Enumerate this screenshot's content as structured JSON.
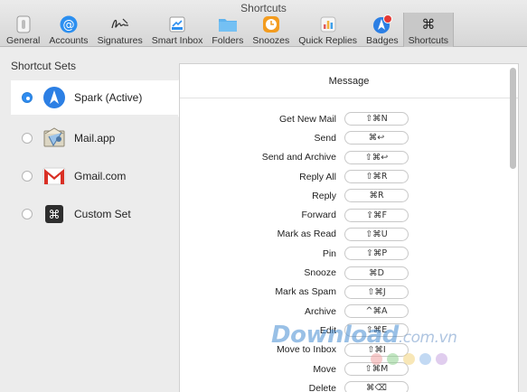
{
  "window": {
    "title": "Shortcuts"
  },
  "toolbar": {
    "items": [
      {
        "label": "General",
        "icon": "switch-icon"
      },
      {
        "label": "Accounts",
        "icon": "at-icon"
      },
      {
        "label": "Signatures",
        "icon": "signature-icon"
      },
      {
        "label": "Smart Inbox",
        "icon": "smart-inbox-icon"
      },
      {
        "label": "Folders",
        "icon": "folder-icon"
      },
      {
        "label": "Snoozes",
        "icon": "clock-icon"
      },
      {
        "label": "Quick Replies",
        "icon": "quick-replies-icon"
      },
      {
        "label": "Badges",
        "icon": "spark-badge-icon"
      },
      {
        "label": "Shortcuts",
        "icon": "command-icon"
      }
    ],
    "active": "Shortcuts"
  },
  "sets": {
    "heading": "Shortcut Sets",
    "items": [
      {
        "label": "Spark (Active)",
        "icon": "spark-icon",
        "selected": true
      },
      {
        "label": "Mail.app",
        "icon": "mail-app-icon",
        "selected": false
      },
      {
        "label": "Gmail.com",
        "icon": "gmail-icon",
        "selected": false
      },
      {
        "label": "Custom Set",
        "icon": "command-key-icon",
        "selected": false
      }
    ]
  },
  "panel": {
    "section": "Message",
    "shortcuts": [
      {
        "action": "Get New Mail",
        "keys": "⇧⌘N"
      },
      {
        "action": "Send",
        "keys": "⌘↩"
      },
      {
        "action": "Send and Archive",
        "keys": "⇧⌘↩"
      },
      {
        "action": "Reply All",
        "keys": "⇧⌘R"
      },
      {
        "action": "Reply",
        "keys": "⌘R"
      },
      {
        "action": "Forward",
        "keys": "⇧⌘F"
      },
      {
        "action": "Mark as Read",
        "keys": "⇧⌘U"
      },
      {
        "action": "Pin",
        "keys": "⇧⌘P"
      },
      {
        "action": "Snooze",
        "keys": "⌘D"
      },
      {
        "action": "Mark as Spam",
        "keys": "⇧⌘J"
      },
      {
        "action": "Archive",
        "keys": "^⌘A"
      },
      {
        "action": "Edit",
        "keys": "⇧⌘E"
      },
      {
        "action": "Move to Inbox",
        "keys": "⇧⌘I"
      },
      {
        "action": "Move",
        "keys": "⇧⌘M"
      },
      {
        "action": "Delete",
        "keys": "⌘⌫"
      }
    ]
  },
  "watermark": {
    "text": "Download",
    "suffix": ".com.vn"
  },
  "colors": {
    "accent": "#2f8cf0",
    "watermark_dots": [
      "#f1a3a3",
      "#8fd18f",
      "#f3d37b",
      "#8fb9ea",
      "#c7a4e0"
    ]
  }
}
